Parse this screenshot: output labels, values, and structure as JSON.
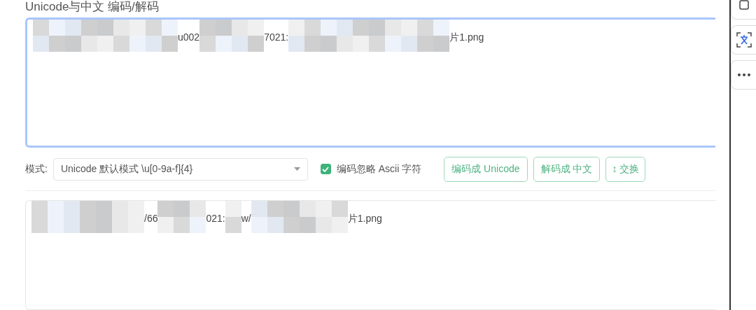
{
  "title": "Unicode与中文 编码/解码",
  "input": {
    "segments": [
      {
        "kind": "mosaic"
      },
      {
        "kind": "text",
        "text": "u002"
      },
      {
        "kind": "mosaic"
      },
      {
        "kind": "text",
        "text": "7021:"
      },
      {
        "kind": "mosaic"
      },
      {
        "kind": "text",
        "text": "片1.png"
      }
    ],
    "focused": true
  },
  "mode": {
    "label": "模式:",
    "value": "Unicode 默认模式 \\u[0-9a-f]{4}"
  },
  "ignore_ascii": {
    "label": "编码忽略 Ascii 字符",
    "checked": true
  },
  "buttons": [
    {
      "kind": "encode",
      "label": "编码成 Unicode"
    },
    {
      "kind": "decode",
      "label": "解码成 中文"
    },
    {
      "kind": "swap",
      "label": "↕ 交换"
    }
  ],
  "output": {
    "segments": [
      {
        "kind": "mosaic"
      },
      {
        "kind": "text",
        "text": "/66"
      },
      {
        "kind": "mosaic"
      },
      {
        "kind": "text",
        "text": "021:"
      },
      {
        "kind": "mosaic"
      },
      {
        "kind": "text",
        "text": "w/"
      },
      {
        "kind": "mosaic"
      },
      {
        "kind": "text",
        "text": "片1.png"
      }
    ]
  }
}
